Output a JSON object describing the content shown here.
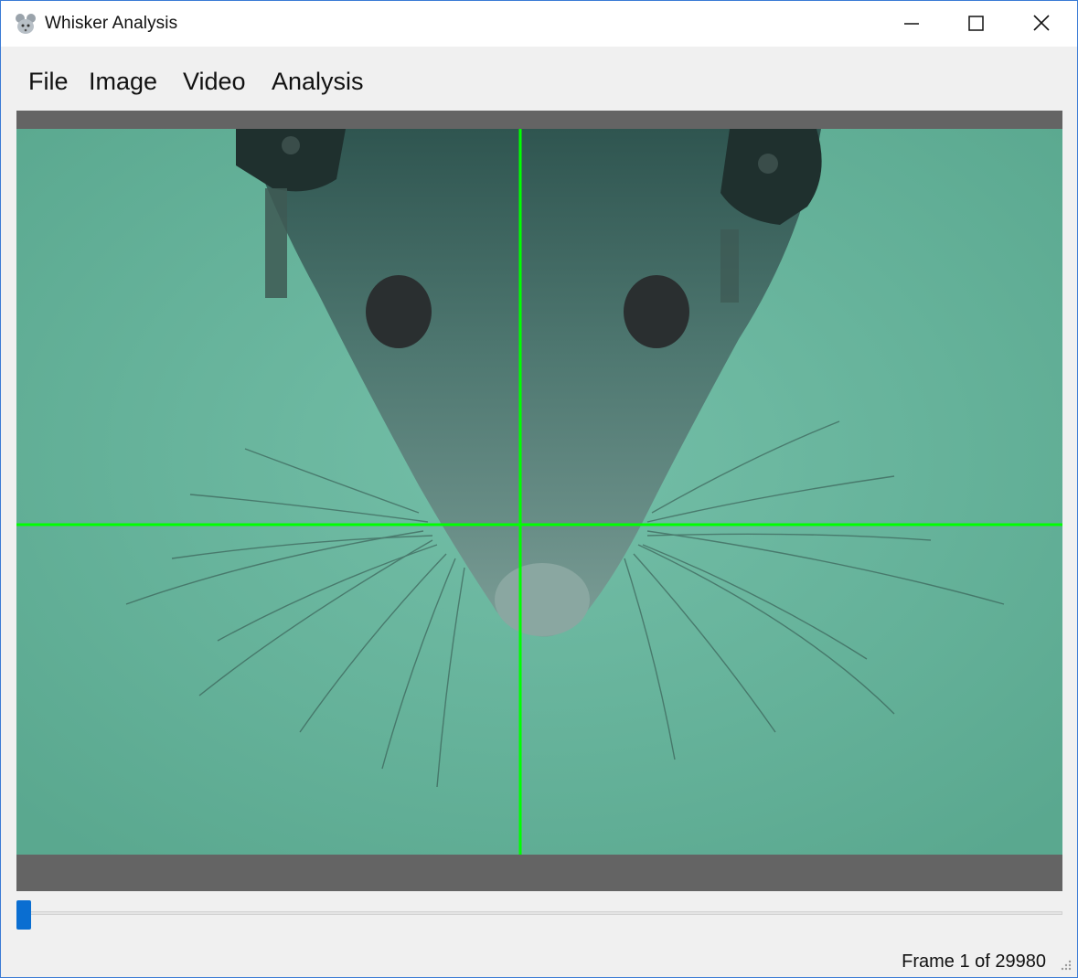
{
  "window": {
    "title": "Whisker Analysis",
    "app_icon": "mouse-icon",
    "controls": [
      "minimize-icon",
      "maximize-icon",
      "close-icon"
    ]
  },
  "menu": {
    "items": [
      {
        "label": "File"
      },
      {
        "label": "Image"
      },
      {
        "label": "Video"
      },
      {
        "label": "Analysis"
      }
    ]
  },
  "viewer": {
    "crosshair_color": "#00ff00",
    "background_color": "#5fad96",
    "letterbox_color": "#646464"
  },
  "slider": {
    "position_fraction": 0,
    "accent_color": "#0a6ed1"
  },
  "status": {
    "frame_text": "Frame 1 of 29980"
  }
}
